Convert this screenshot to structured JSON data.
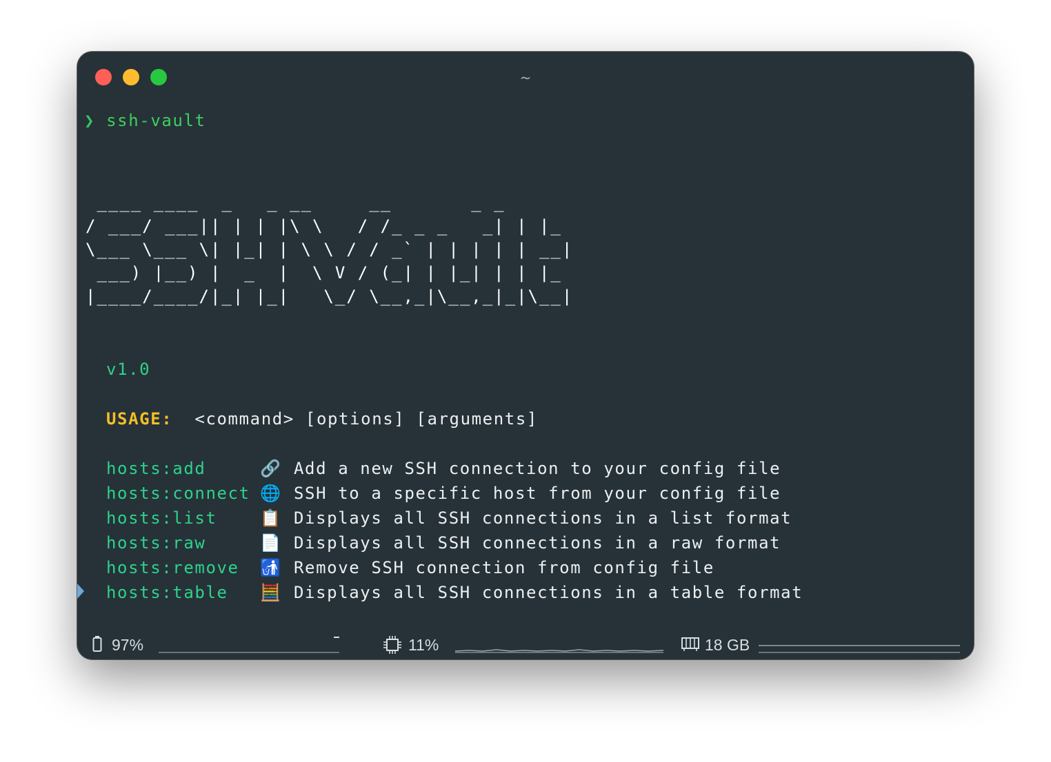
{
  "window": {
    "title": "~"
  },
  "terminal": {
    "prompt_symbol": "❯",
    "command": "ssh-vault",
    "ascii_art": [
      " ____ ____  _   _ __     __       _ _   ",
      "/ ___/ ___|| | | |\\ \\   / /_ _ _   _| | |_ ",
      "\\___ \\___ \\| |_| | \\ \\ / / _` | | | | | __|",
      " ___) |__) |  _  |  \\ V / (_| | |_| | | |_ ",
      "|____/____/|_| |_|   \\_/ \\__,_|\\__,_|_|\\__|"
    ],
    "version": "v1.0",
    "usage_label": "USAGE:",
    "usage_text": "<command> [options] [arguments]",
    "commands": [
      {
        "name": "hosts:add",
        "icon": "link-icon",
        "glyph": "🔗",
        "description": "Add a new SSH connection to your config file"
      },
      {
        "name": "hosts:connect",
        "icon": "globe-icon",
        "glyph": "🌐",
        "description": "SSH to a specific host from your config file"
      },
      {
        "name": "hosts:list",
        "icon": "clipboard-icon",
        "glyph": "📋",
        "description": "Displays all SSH connections in a list format"
      },
      {
        "name": "hosts:raw",
        "icon": "page-icon",
        "glyph": "📄",
        "description": "Displays all SSH connections in a raw format"
      },
      {
        "name": "hosts:remove",
        "icon": "trash-icon",
        "glyph": "🚮",
        "description": "Remove SSH connection from config file"
      },
      {
        "name": "hosts:table",
        "icon": "abacus-icon",
        "glyph": "🧮",
        "description": "Displays all SSH connections in a table format"
      }
    ]
  },
  "status_bar": {
    "battery": {
      "icon": "battery-icon",
      "value": "97%"
    },
    "cpu": {
      "icon": "cpu-icon",
      "value": "11%"
    },
    "memory": {
      "icon": "memory-icon",
      "value": "18 GB"
    }
  },
  "colors": {
    "background": "#263238",
    "prompt": "#34c759",
    "command_green": "#2ed28b",
    "usage_yellow": "#f4c025",
    "text": "#eceff1"
  }
}
